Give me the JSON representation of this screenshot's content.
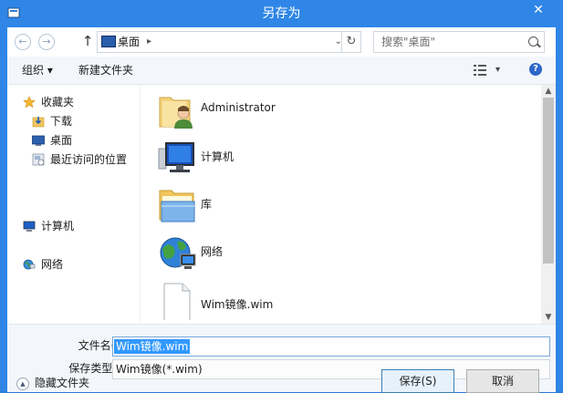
{
  "window": {
    "title": "另存为",
    "close_glyph": "✕"
  },
  "nav": {
    "back_glyph": "←",
    "forward_glyph": "→",
    "up_glyph": "↑",
    "address_text": "桌面",
    "address_arrow": "▸",
    "dropdown_glyph": "⌄",
    "refresh_glyph": "↻",
    "search_placeholder": "搜索\"桌面\""
  },
  "toolbar": {
    "organize_label": "组织 ▾",
    "new_folder_label": "新建文件夹",
    "view_glyph": "▾",
    "help_glyph": "?"
  },
  "sidebar": {
    "items": [
      {
        "label": "收藏夹",
        "icon": "star-icon"
      },
      {
        "label": "下载",
        "icon": "download-icon"
      },
      {
        "label": "桌面",
        "icon": "desktop-icon"
      },
      {
        "label": "最近访问的位置",
        "icon": "recent-places-icon"
      },
      {
        "label": "计算机",
        "icon": "computer-icon"
      },
      {
        "label": "网络",
        "icon": "network-icon"
      }
    ]
  },
  "files": [
    {
      "name": "Administrator",
      "icon": "user-folder-icon"
    },
    {
      "name": "计算机",
      "icon": "computer-icon"
    },
    {
      "name": "库",
      "icon": "library-icon"
    },
    {
      "name": "网络",
      "icon": "network-icon"
    },
    {
      "name": "Wim镜像.wim",
      "icon": "file-icon"
    }
  ],
  "form": {
    "filename_label": "文件名(N):",
    "filename_value": "Wim镜像.wim",
    "filetype_label": "保存类型(T):",
    "filetype_value": "Wim镜像(*.wim)",
    "hide_folders_label": "隐藏文件夹",
    "hide_folders_glyph": "▲",
    "save_label": "保存(S)",
    "cancel_label": "取消"
  },
  "scrollbar": {
    "up_glyph": "▲",
    "down_glyph": "▼"
  }
}
